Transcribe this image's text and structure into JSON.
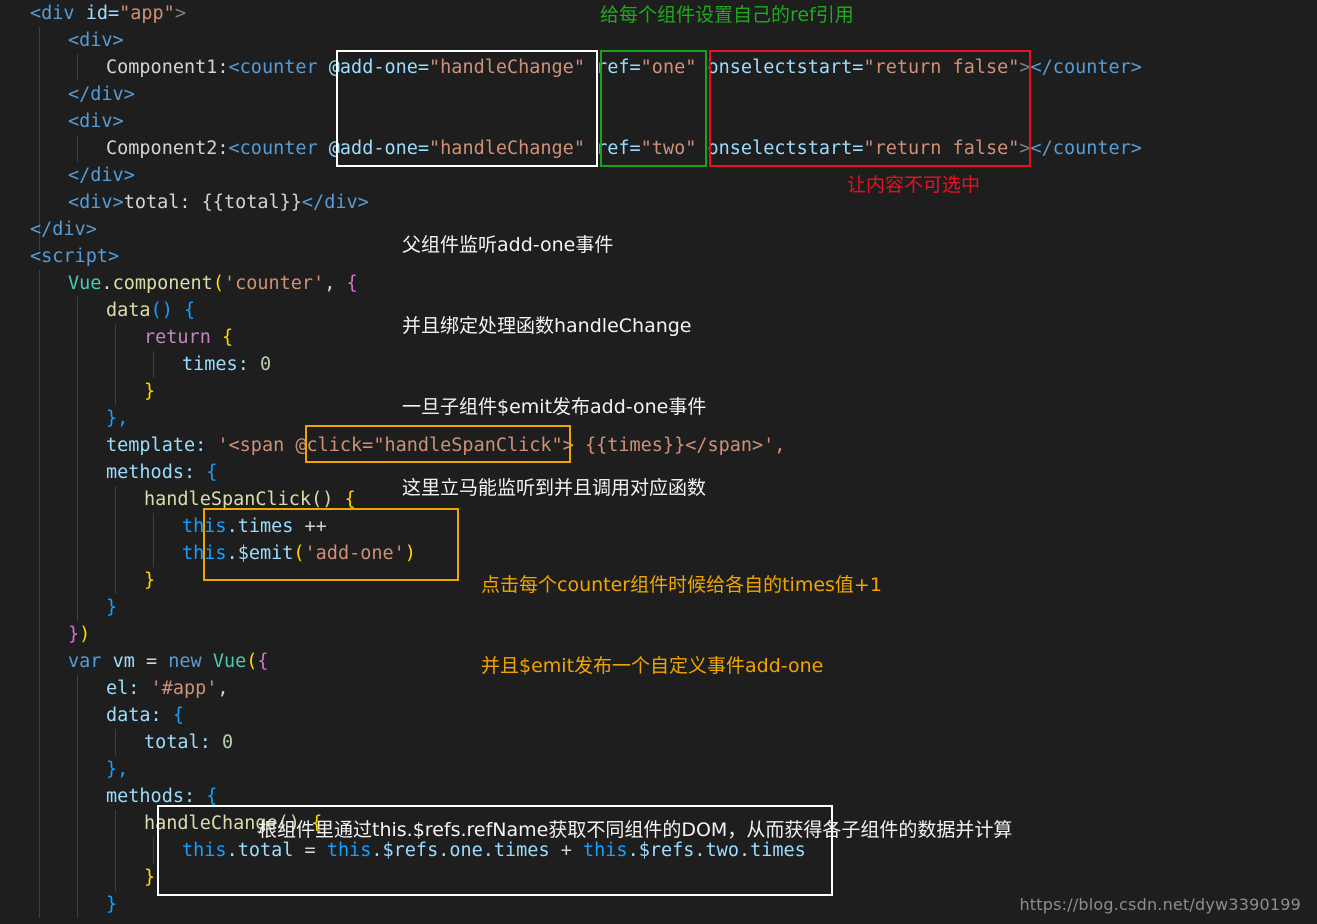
{
  "editor": {
    "background_color": "#1e1e1e",
    "default_text_color": "#d4d4d4",
    "font_size_px": 18.5,
    "line_height_px": 27,
    "code_lines": [
      "<div id=\"app\">",
      "    <div>",
      "        Component1:<counter @add-one=\"handleChange\" ref=\"one\" onselectstart=\"return false\"></counter>",
      "    </div>",
      "    <div>",
      "        Component2:<counter @add-one=\"handleChange\" ref=\"two\" onselectstart=\"return false\"></counter>",
      "    </div>",
      "    <div>total: {{total}}</div>",
      "</div>",
      "<script>",
      "    Vue.component('counter', {",
      "        data() {",
      "            return {",
      "                times: 0",
      "            }",
      "        },",
      "        template: '<span @click=\"handleSpanClick\"> {{times}}</span>',",
      "        methods: {",
      "            handleSpanClick() {",
      "                this.times ++",
      "                this.$emit('add-one')",
      "            }",
      "        }",
      "    })",
      "    var vm = new Vue({",
      "        el: '#app',",
      "        data: {",
      "            total: 0",
      "        },",
      "        methods: {",
      "            handleChange() {",
      "                this.total = this.$refs.one.times + this.$refs.two.times",
      "            }",
      "        }"
    ]
  },
  "code_tokens": {
    "l1_div_open": "<div",
    "l1_id_attr": "id=",
    "l1_id_val": "\"app\"",
    "l1_close": ">",
    "div_open": "<div>",
    "div_close": "</div>",
    "component1_label": "Component1:",
    "component2_label": "Component2:",
    "counter_open": "<counter",
    "counter_close": "</counter>",
    "add_one_attr": "@add-one=",
    "add_one_val": "\"handleChange\"",
    "ref_attr": "ref=",
    "ref_one_val": "\"one\"",
    "ref_two_val": "\"two\"",
    "onselectstart_attr": "onselectstart=",
    "onselectstart_val": "\"return false\"",
    "gt": ">",
    "total_line_text": "total: {{total}}",
    "script_open": "<script>",
    "vue_obj": "Vue",
    "dot": ".",
    "component_fn": "component",
    "paren_open": "(",
    "counter_str": "'counter'",
    "comma": ",",
    "brace_open": "{",
    "data_fn": "data",
    "parens": "()",
    "return_kw": "return",
    "times_prop": "times:",
    "zero": "0",
    "brace_close": "}",
    "brace_close_comma": "},",
    "template_prop": "template:",
    "template_str_start": "'<span",
    "click_attr": "@click=",
    "click_val": "\"handleSpanClick\"",
    "template_str_rest": "> {{times}}</span>',",
    "methods_prop": "methods:",
    "handle_span_click": "handleSpanClick()",
    "this_kw": "this",
    "times_member": ".times",
    "plusplus": "++",
    "emit_member": ".$emit",
    "add_one_str": "'add-one'",
    "close_paren_brace": "})",
    "var_kw": "var",
    "vm_name": "vm",
    "equals": "=",
    "new_kw": "new",
    "vue_ctor": "Vue",
    "el_prop": "el:",
    "app_str": "'#app'",
    "data_prop": "data:",
    "total_prop": "total:",
    "handle_change": "handleChange()",
    "total_member": ".total",
    "refs_one_times": ".$refs.one.times",
    "refs_two_times": ".$refs.two.times",
    "plus": "+"
  },
  "annotations": [
    {
      "id": "ref-note",
      "color": "#1faa1f",
      "text": "给每个组件设置自己的ref引用"
    },
    {
      "id": "unselectable-note",
      "color": "#e81123",
      "text": "让内容不可选中"
    },
    {
      "id": "parent-listen-note",
      "color": "#f2f2f2",
      "lines": [
        "父组件监听add-one事件",
        "并且绑定处理函数handleChange",
        "一旦子组件$emit发布add-one事件",
        "这里立马能监听到并且调用对应函数"
      ]
    },
    {
      "id": "click-emit-note",
      "color": "#f0a500",
      "lines": [
        "点击每个counter组件时候给各自的times值+1",
        "并且$emit发布一个自定义事件add-one"
      ]
    },
    {
      "id": "refs-dom-note",
      "color": "#f2f2f2",
      "lines": [
        "根组件里通过this.$refs.refName获取不同组件的DOM，从而获得各子组件的数据并计算"
      ]
    }
  ],
  "highlight_boxes": [
    {
      "id": "add-one-box",
      "color": "#ffffff",
      "label": "white box around @add-one bindings"
    },
    {
      "id": "ref-box",
      "color": "#19a319",
      "label": "green box around ref attributes"
    },
    {
      "id": "onselectstart-box",
      "color": "#e81123",
      "label": "red box around onselectstart attributes"
    },
    {
      "id": "click-box",
      "color": "#f0a500",
      "label": "orange box around @click in template"
    },
    {
      "id": "emit-box",
      "color": "#f0a500",
      "label": "orange box around this.times ++ / this.$emit"
    },
    {
      "id": "handlechange-box",
      "color": "#ffffff",
      "label": "white box around handleChange method"
    }
  ],
  "watermark": {
    "text": "https://blog.csdn.net/dyw3390199"
  }
}
